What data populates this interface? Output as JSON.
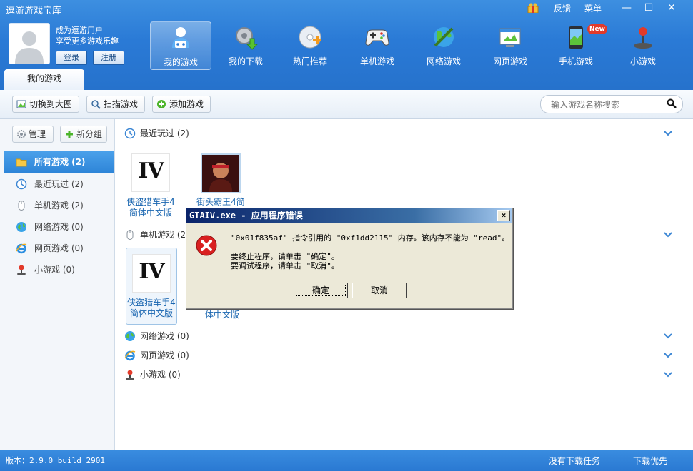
{
  "app": {
    "title": "逗游游戏宝库"
  },
  "topmenu": {
    "feedback": "反馈",
    "menu": "菜单"
  },
  "window_controls": {
    "minimize": "—",
    "maximize": "☐",
    "close": "✕"
  },
  "user": {
    "line1": "成为逗游用户",
    "line2": "享受更多游戏乐趣",
    "login": "登录",
    "register": "注册"
  },
  "nav": [
    {
      "label": "我的游戏",
      "icon": "my-games-icon",
      "active": true
    },
    {
      "label": "我的下载",
      "icon": "download-gear-icon"
    },
    {
      "label": "热门推荐",
      "icon": "hot-disc-icon"
    },
    {
      "label": "单机游戏",
      "icon": "gamepad-icon"
    },
    {
      "label": "网络游戏",
      "icon": "globe-icon"
    },
    {
      "label": "网页游戏",
      "icon": "webpage-icon"
    },
    {
      "label": "手机游戏",
      "icon": "phone-icon",
      "badge": "New"
    },
    {
      "label": "小游戏",
      "icon": "joystick-icon"
    }
  ],
  "tab": {
    "label": "我的游戏"
  },
  "toolbar": {
    "switch_view": "切换到大图",
    "scan": "扫描游戏",
    "add": "添加游戏"
  },
  "search": {
    "placeholder": "输入游戏名称搜索"
  },
  "sidebar": {
    "manage": "管理",
    "new_group": "新分组",
    "items": [
      {
        "label": "所有游戏 (2)",
        "icon": "folder-icon",
        "active": true
      },
      {
        "label": "最近玩过 (2)",
        "icon": "clock-icon"
      },
      {
        "label": "单机游戏 (2)",
        "icon": "mouse-icon"
      },
      {
        "label": "网络游戏 (0)",
        "icon": "globe-icon"
      },
      {
        "label": "网页游戏 (0)",
        "icon": "ie-icon"
      },
      {
        "label": "小游戏 (0)",
        "icon": "joystick-icon"
      }
    ]
  },
  "sections": {
    "recent": {
      "label": "最近玩过",
      "count": "(2)"
    },
    "single": {
      "label": "单机游戏",
      "count": "(2)"
    },
    "online": {
      "label": "网络游戏",
      "count": "(0)"
    },
    "web": {
      "label": "网页游戏",
      "count": "(0)"
    },
    "mini": {
      "label": "小游戏",
      "count": "(0)"
    }
  },
  "games": {
    "recent_1": {
      "line1": "侠盗猎车手4",
      "line2": "简体中文版",
      "logo": "IV"
    },
    "recent_2": {
      "line1": "街头霸王4简",
      "line2": ""
    },
    "single_1": {
      "line1": "侠盗猎车手4",
      "line2": "简体中文版",
      "logo": "IV"
    },
    "single_2": {
      "line1": "体中文版"
    }
  },
  "dialog": {
    "title": "GTAIV.exe - 应用程序错误",
    "close": "×",
    "message": "\"0x01f835af\" 指令引用的 \"0xf1dd2115\" 内存。该内存不能为 \"read\"。",
    "hint1": "要终止程序，请单击 \"确定\"。",
    "hint2": "要调试程序，请单击 \"取消\"。",
    "ok": "确定",
    "cancel": "取消"
  },
  "status": {
    "version": "版本：2.9.0 build 2901",
    "no_task": "没有下载任务",
    "priority": "下载优先"
  },
  "colors": {
    "header": "#2a7ad6",
    "accent": "#2e85d8",
    "link": "#1a66b0",
    "dialog_title": "#0a246a",
    "error_red": "#d92020"
  }
}
